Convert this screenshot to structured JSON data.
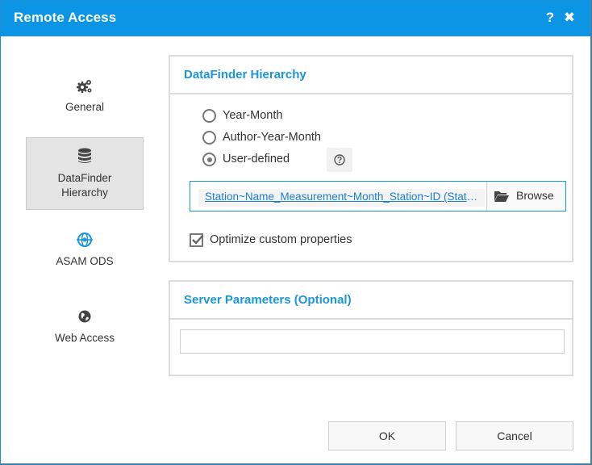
{
  "window": {
    "title": "Remote Access",
    "help_label": "?",
    "close_label": "✖"
  },
  "nav": {
    "items": [
      {
        "label": "General",
        "icon": "gears-icon",
        "selected": false
      },
      {
        "label": "DataFinder\nHierarchy",
        "icon": "database-icon",
        "selected": true
      },
      {
        "label": "ASAM ODS",
        "icon": "asam-ods-icon",
        "selected": false
      },
      {
        "label": "Web Access",
        "icon": "globe-icon",
        "selected": false
      }
    ]
  },
  "hierarchy": {
    "title": "DataFinder Hierarchy",
    "options": [
      {
        "label": "Year-Month",
        "checked": false
      },
      {
        "label": "Author-Year-Month",
        "checked": false
      },
      {
        "label": "User-defined",
        "checked": true
      }
    ],
    "path_value": "Station~Name_Measurement~Month_Station~ID (Station~Name)",
    "browse_label": "Browse",
    "optimize_label": "Optimize custom properties",
    "optimize_checked": true
  },
  "server": {
    "title": "Server Parameters (Optional)",
    "value": ""
  },
  "footer": {
    "ok_label": "OK",
    "cancel_label": "Cancel"
  },
  "colors": {
    "accent": "#0b95e4",
    "link": "#1b7fd0",
    "panel_title": "#1b96d9"
  }
}
